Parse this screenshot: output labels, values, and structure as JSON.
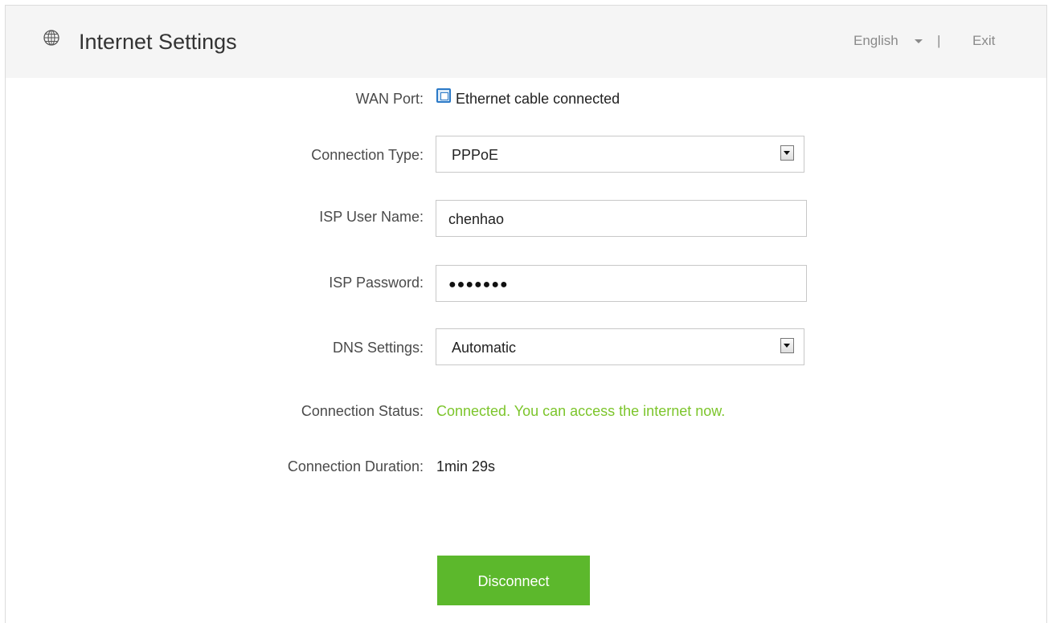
{
  "header": {
    "title": "Internet Settings",
    "language": "English",
    "separator": "|",
    "exit": "Exit",
    "icon": "globe-icon"
  },
  "form": {
    "wan_port": {
      "label": "WAN Port:",
      "value": "Ethernet cable connected",
      "icon": "ethernet-port-icon"
    },
    "connection_type": {
      "label": "Connection Type:",
      "value": "PPPoE"
    },
    "isp_user_name": {
      "label": "ISP User Name:",
      "value": "chenhao"
    },
    "isp_password": {
      "label": "ISP Password:",
      "masked_value": "●●●●●●●"
    },
    "dns_settings": {
      "label": "DNS Settings:",
      "value": "Automatic"
    },
    "connection_status": {
      "label": "Connection Status:",
      "value": "Connected. You can access the internet now."
    },
    "connection_duration": {
      "label": "Connection Duration:",
      "value": "1min 29s"
    }
  },
  "actions": {
    "disconnect_label": "Disconnect"
  },
  "colors": {
    "header_bg": "#f5f5f5",
    "accent_green": "#5cb82c",
    "status_green": "#7cc52b",
    "wan_icon_blue": "#2a79c7"
  }
}
